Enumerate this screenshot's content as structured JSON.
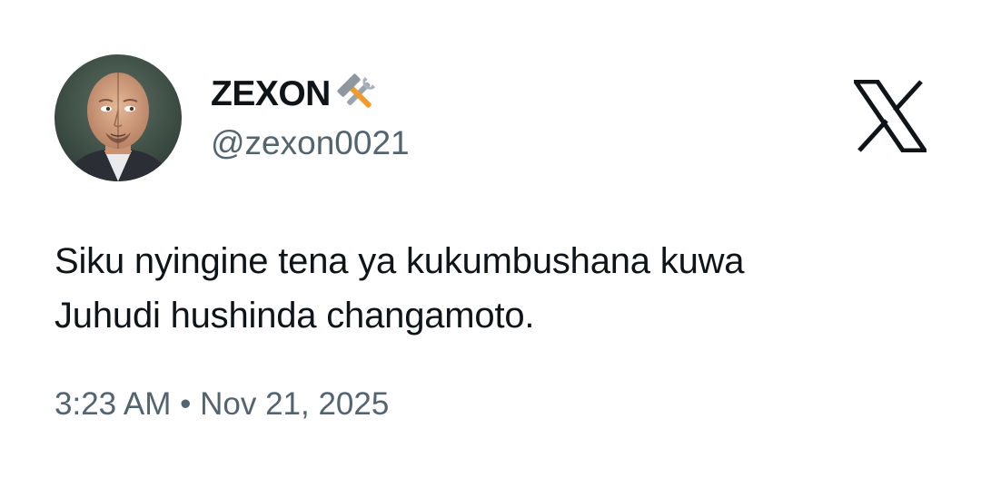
{
  "author": {
    "display_name": "ZEXON",
    "name_emoji": "hammer-and-wrench-icon",
    "handle": "@zexon0021"
  },
  "platform_logo": "x-logo-icon",
  "tweet": {
    "lines": [
      "Siku nyingine tena ya kukumbushana kuwa",
      "Juhudi hushinda changamoto."
    ]
  },
  "timestamp": "3:23 AM • Nov 21, 2025",
  "colors": {
    "text_primary": "#0f1419",
    "text_secondary": "#536471",
    "background": "#ffffff"
  }
}
